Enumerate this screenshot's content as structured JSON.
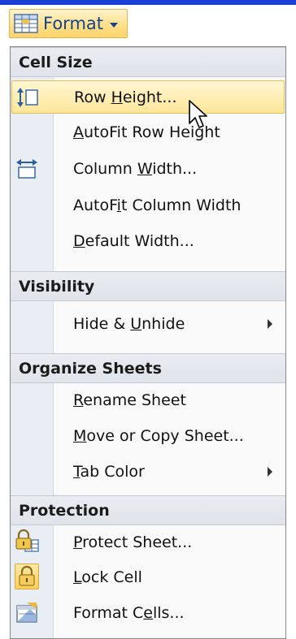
{
  "toolbar": {
    "format_label": "Format",
    "format_icon": "format-grid-icon"
  },
  "sections": [
    {
      "title": "Cell Size",
      "items": [
        {
          "pre": "Row ",
          "key": "H",
          "post": "eight...",
          "icon": "row-height-icon",
          "highlighted": true
        },
        {
          "pre": "",
          "key": "A",
          "post": "utoFit Row Height",
          "icon": null
        },
        {
          "pre": "Column ",
          "key": "W",
          "post": "idth...",
          "icon": "column-width-icon"
        },
        {
          "pre": "AutoF",
          "key": "i",
          "post": "t Column Width",
          "icon": null
        },
        {
          "pre": "",
          "key": "D",
          "post": "efault Width...",
          "icon": null
        }
      ]
    },
    {
      "title": "Visibility",
      "items": [
        {
          "pre": "Hide & ",
          "key": "U",
          "post": "nhide",
          "icon": null,
          "submenu": true
        }
      ]
    },
    {
      "title": "Organize Sheets",
      "items": [
        {
          "pre": "",
          "key": "R",
          "post": "ename Sheet",
          "icon": null
        },
        {
          "pre": "",
          "key": "M",
          "post": "ove or Copy Sheet...",
          "icon": null
        },
        {
          "pre": "",
          "key": "T",
          "post": "ab Color",
          "icon": null,
          "submenu": true
        }
      ]
    },
    {
      "title": "Protection",
      "items": [
        {
          "pre": "",
          "key": "P",
          "post": "rotect Sheet...",
          "icon": "protect-sheet-icon"
        },
        {
          "pre": "",
          "key": "L",
          "post": "ock Cell",
          "icon": "lock-cell-icon"
        },
        {
          "pre": "Format C",
          "key": "e",
          "post": "lls...",
          "icon": "format-cells-icon"
        }
      ]
    }
  ]
}
